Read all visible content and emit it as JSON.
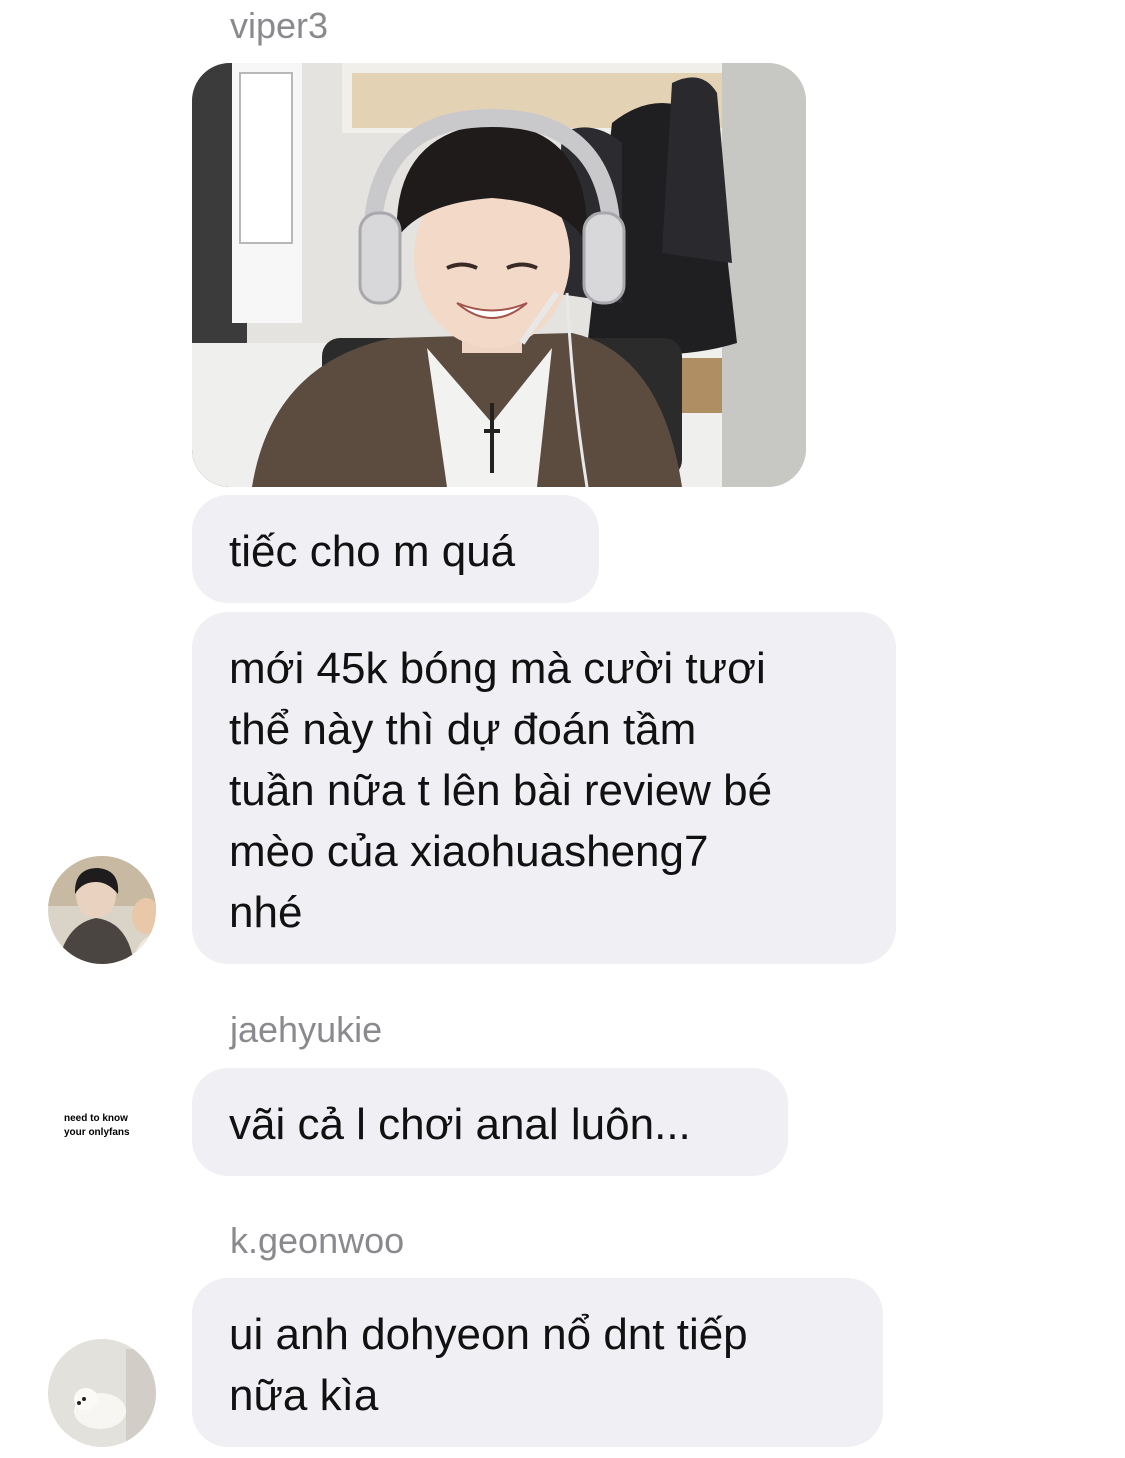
{
  "messages": [
    {
      "sender": "viper3",
      "photo": "photo of smiling person wearing headphones in an office",
      "bubbles": [
        "tiếc cho m quá",
        "mới 45k bóng mà cười tươi\nthể này thì dự đoán tầm\ntuần nữa t lên bài review bé\nmèo của xiaohuasheng7\nnhé"
      ]
    },
    {
      "sender": "jaehyukie",
      "avatar_text": "need to know\nyour onlyfans",
      "bubbles": [
        "vãi cả l chơi anal luôn..."
      ]
    },
    {
      "sender": "k.geonwoo",
      "bubbles": [
        "ui anh dohyeon nổ dnt tiếp\nnữa kìa"
      ]
    }
  ],
  "colors": {
    "bubble": "#efeff4",
    "sender_name": "#8a8a8e",
    "text": "#111111"
  }
}
